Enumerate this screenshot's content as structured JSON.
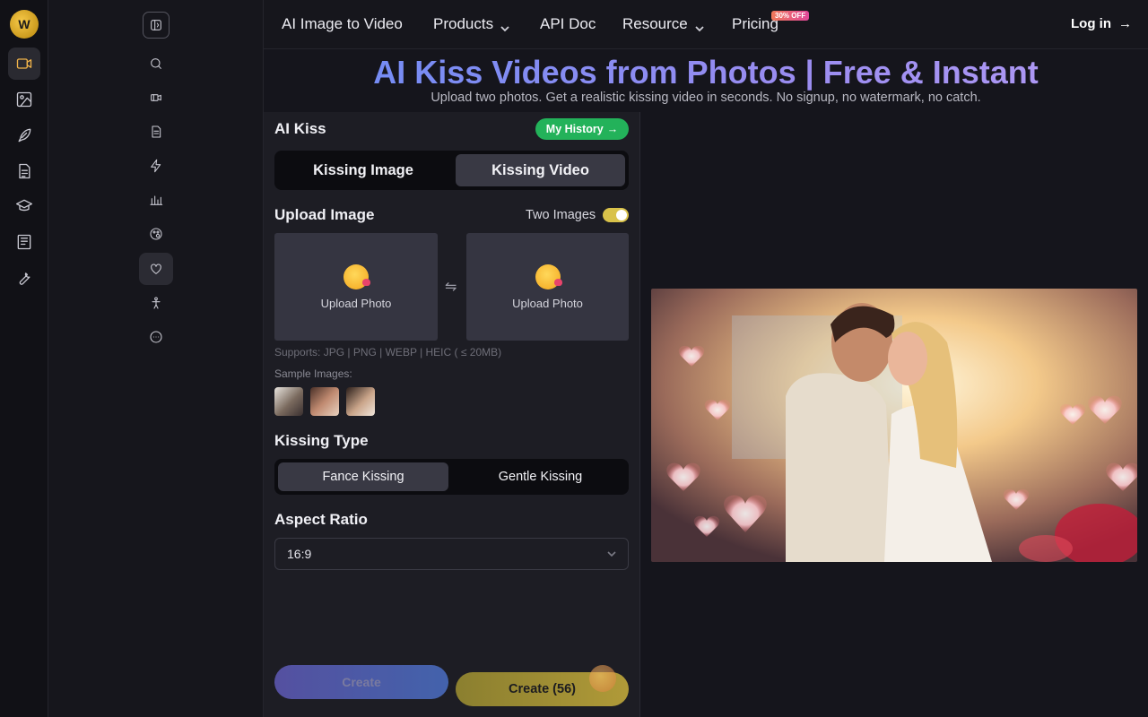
{
  "rail": {
    "items": [
      {
        "name": "video-icon",
        "active": true
      },
      {
        "name": "image-icon",
        "active": false
      },
      {
        "name": "pen-icon",
        "active": false
      },
      {
        "name": "document-icon",
        "active": false
      },
      {
        "name": "graduation-cap-icon",
        "active": false
      },
      {
        "name": "news-icon",
        "active": false
      },
      {
        "name": "wrench-icon",
        "active": false
      }
    ]
  },
  "sidebar": {
    "items": [
      {
        "name": "search-icon"
      },
      {
        "name": "video-clip-icon"
      },
      {
        "name": "file-icon"
      },
      {
        "name": "lightning-icon"
      },
      {
        "name": "bar-chart-icon"
      },
      {
        "name": "palette-icon"
      },
      {
        "name": "heart-icon",
        "active": true
      },
      {
        "name": "dance-icon"
      },
      {
        "name": "more-icon"
      }
    ]
  },
  "nav": {
    "items": [
      "AI Image to Video",
      "Products",
      "API Doc",
      "Resource",
      "Pricing"
    ],
    "pricing_badge": "30% OFF",
    "login": "Log in",
    "login_arrow": "→"
  },
  "hero": {
    "title": "AI Kiss Videos from Photos | Free & Instant",
    "subtitle": "Upload two photos. Get a realistic kissing video in seconds. No signup, no watermark, no catch."
  },
  "panel": {
    "title": "AI Kiss",
    "history": "My History",
    "history_arrow": "→",
    "mode_tabs": [
      "Kissing Image",
      "Kissing Video"
    ],
    "mode_selected": "Kissing Video",
    "upload_label": "Upload Image",
    "two_images_label": "Two Images",
    "two_images_on": true,
    "upload_photo_1": "Upload Photo",
    "upload_photo_2": "Upload Photo",
    "swap_symbol": "⇋",
    "supports": "Supports: JPG | PNG | WEBP | HEIC ( ≤ 20MB)",
    "sample_label": "Sample Images:",
    "kissing_type_label": "Kissing Type",
    "kissing_types": [
      "Fance Kissing",
      "Gentle Kissing"
    ],
    "kissing_type_selected": "Fance Kissing",
    "aspect_ratio_label": "Aspect Ratio",
    "aspect_ratio_value": "16:9",
    "create_label": "Create",
    "create_credit_label": "Create (56)"
  },
  "colors": {
    "accent_gold": "#f0b34a",
    "history_green": "#23b25a",
    "toggle_yellow": "#d9c24a"
  }
}
